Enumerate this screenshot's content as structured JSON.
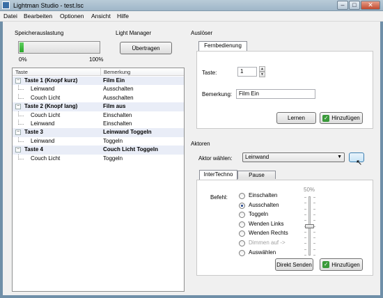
{
  "window": {
    "title": "Lightman Studio - test.lsc"
  },
  "menu": [
    "Datei",
    "Bearbeiten",
    "Optionen",
    "Ansicht",
    "Hilfe"
  ],
  "speicher": {
    "caption": "Speicherauslastung",
    "min_label": "0%",
    "max_label": "100%",
    "value_percent": 5
  },
  "light_manager": {
    "caption": "Light Manager",
    "button": "Übertragen"
  },
  "list": {
    "col_taste": "Taste",
    "col_bemerkung": "Bemerkung",
    "rows": [
      {
        "name": "Taste 1 (Knopf kurz)",
        "note": "Film Ein",
        "level": 0
      },
      {
        "name": "Leinwand",
        "note": "Ausschalten",
        "level": 1
      },
      {
        "name": "Couch Licht",
        "note": "Ausschalten",
        "level": 1
      },
      {
        "name": "Taste 2 (Knopf lang)",
        "note": "Film aus",
        "level": 0
      },
      {
        "name": "Couch Licht",
        "note": "Einschalten",
        "level": 1
      },
      {
        "name": "Leinwand",
        "note": "Einschalten",
        "level": 1
      },
      {
        "name": "Taste 3",
        "note": "Leinwand Toggeln",
        "level": 0
      },
      {
        "name": "Leinwand",
        "note": "Toggeln",
        "level": 1
      },
      {
        "name": "Taste 4",
        "note": "Couch Licht Toggeln",
        "level": 0
      },
      {
        "name": "Couch Licht",
        "note": "Toggeln",
        "level": 1
      }
    ]
  },
  "ausloeser": {
    "caption": "Auslöser",
    "tab": "Fernbedienung",
    "taste_label": "Taste:",
    "taste_value": "1",
    "bemerkung_label": "Bemerkung:",
    "bemerkung_value": "Film Ein",
    "lernen": "Lernen",
    "hinzufuegen": "Hinzufügen"
  },
  "aktoren": {
    "caption": "Aktoren",
    "aktor_label": "Aktor wählen:",
    "aktor_value": "Leinwand",
    "tabs": [
      "InterTechno",
      "Pause"
    ],
    "befehl_label": "Befehl:",
    "options": [
      {
        "label": "Einschalten",
        "selected": false,
        "disabled": false
      },
      {
        "label": "Ausschalten",
        "selected": true,
        "disabled": false
      },
      {
        "label": "Toggeln",
        "selected": false,
        "disabled": false
      },
      {
        "label": "Wenden Links",
        "selected": false,
        "disabled": false
      },
      {
        "label": "Wenden Rechts",
        "selected": false,
        "disabled": false
      },
      {
        "label": "Dimmen auf ->",
        "selected": false,
        "disabled": true
      },
      {
        "label": "Auswählen",
        "selected": false,
        "disabled": false
      }
    ],
    "slider_label": "50%",
    "slider_value": 50,
    "direkt_senden": "Direkt Senden",
    "hinzufuegen": "Hinzufügen"
  }
}
